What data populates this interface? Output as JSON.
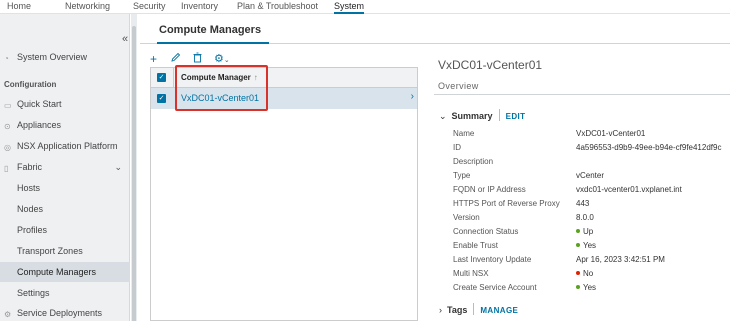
{
  "topnav": {
    "items": [
      "Home",
      "Networking",
      "Security",
      "Inventory",
      "Plan & Troubleshoot",
      "System"
    ],
    "active": "System"
  },
  "sidebar": {
    "collapse_glyph": "«",
    "system_overview": "System Overview",
    "configuration_header": "Configuration",
    "quick_start": "Quick Start",
    "appliances": "Appliances",
    "nsx_app_platform": "NSX Application Platform",
    "fabric": "Fabric",
    "hosts": "Hosts",
    "nodes": "Nodes",
    "profiles": "Profiles",
    "transport_zones": "Transport Zones",
    "compute_managers": "Compute Managers",
    "settings": "Settings",
    "service_deployments": "Service Deployments"
  },
  "page": {
    "title": "Compute Managers"
  },
  "grid": {
    "column_header": "Compute Manager",
    "sort_glyph": "↑",
    "rows": [
      {
        "name": "VxDC01-vCenter01",
        "selected": true
      }
    ]
  },
  "detail": {
    "title": "VxDC01-vCenter01",
    "tab": "Overview",
    "summary_label": "Summary",
    "edit_label": "EDIT",
    "tags_label": "Tags",
    "manage_label": "MANAGE",
    "fields": [
      {
        "key": "Name",
        "value": "VxDC01-vCenter01"
      },
      {
        "key": "ID",
        "value": "4a596553-d9b9-49ee-b94e-cf9fe412df9c"
      },
      {
        "key": "Description",
        "value": ""
      },
      {
        "key": "Type",
        "value": "vCenter"
      },
      {
        "key": "FQDN or IP Address",
        "value": "vxdc01-vcenter01.vxplanet.int"
      },
      {
        "key": "HTTPS Port of Reverse Proxy",
        "value": "443"
      },
      {
        "key": "Version",
        "value": "8.0.0"
      },
      {
        "key": "Connection Status",
        "value": "Up",
        "status": "green"
      },
      {
        "key": "Enable Trust",
        "value": "Yes",
        "status": "green"
      },
      {
        "key": "Last Inventory Update",
        "value": "Apr 16, 2023 3:42:51 PM"
      },
      {
        "key": "Multi NSX",
        "value": "No",
        "status": "red"
      },
      {
        "key": "Create Service Account",
        "value": "Yes",
        "status": "green"
      }
    ]
  },
  "colors": {
    "accent": "#0072a3",
    "status_green": "#5aa220",
    "status_red": "#e12200",
    "highlight_box": "#d9322b"
  }
}
